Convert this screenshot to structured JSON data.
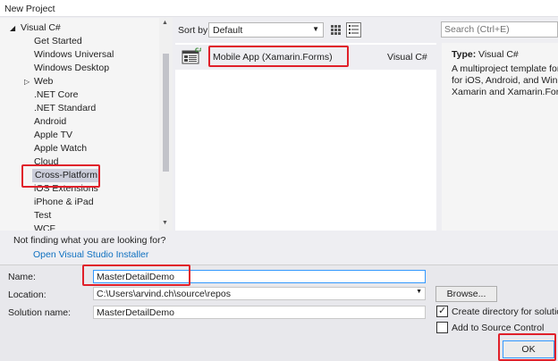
{
  "window": {
    "title": "New Project"
  },
  "tree": {
    "items": [
      {
        "label": "Visual C#",
        "arrow": "◢"
      },
      {
        "label": "Get Started"
      },
      {
        "label": "Windows Universal"
      },
      {
        "label": "Windows Desktop"
      },
      {
        "label": "Web",
        "arrow": "▷"
      },
      {
        "label": ".NET Core"
      },
      {
        "label": ".NET Standard"
      },
      {
        "label": "Android"
      },
      {
        "label": "Apple TV"
      },
      {
        "label": "Apple Watch"
      },
      {
        "label": "Cloud"
      },
      {
        "label": "Cross-Platform"
      },
      {
        "label": "iOS Extensions"
      },
      {
        "label": "iPhone & iPad"
      },
      {
        "label": "Test"
      },
      {
        "label": "WCF"
      }
    ],
    "not_found": "Not finding what you are looking for?",
    "installer_link": "Open Visual Studio Installer"
  },
  "toolbar": {
    "sort_label": "Sort by:",
    "sort_value": "Default",
    "search_placeholder": "Search (Ctrl+E)"
  },
  "templates": [
    {
      "name": "Mobile App (Xamarin.Forms)",
      "language": "Visual C#"
    }
  ],
  "description": {
    "type_label": "Type:",
    "type_value": "Visual C#",
    "lines": [
      "A multiproject template for b",
      "for iOS, Android, and Windo",
      "Xamarin and Xamarin.Forms"
    ]
  },
  "form": {
    "name_label": "Name:",
    "name_value": "MasterDetailDemo",
    "location_label": "Location:",
    "location_value": "C:\\Users\\arvind.ch\\source\\repos",
    "solution_label": "Solution name:",
    "solution_value": "MasterDetailDemo",
    "browse_label": "Browse...",
    "create_dir_label": "Create directory for solution",
    "source_control_label": "Add to Source Control",
    "ok_label": "OK"
  },
  "colors": {
    "accent_red": "#e0202a",
    "link": "#0e70c0"
  }
}
